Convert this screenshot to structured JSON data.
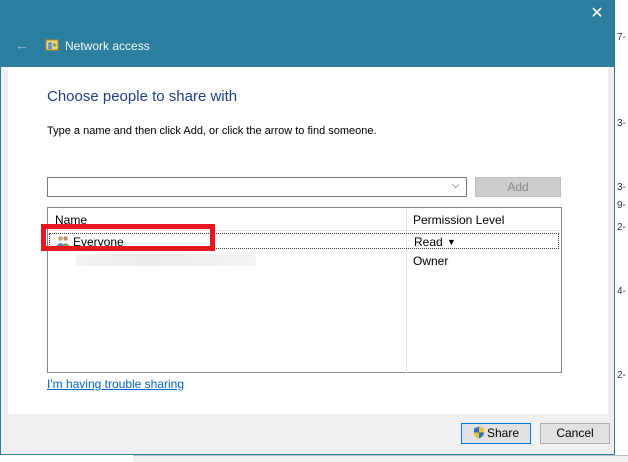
{
  "window": {
    "title": "Network access",
    "heading": "Choose people to share with",
    "instruction": "Type a name and then click Add, or click the arrow to find someone."
  },
  "name_input": {
    "value": "",
    "add_label": "Add"
  },
  "list": {
    "columns": [
      "Name",
      "Permission Level"
    ],
    "rows": [
      {
        "name": "Everyone",
        "permission": "Read"
      },
      {
        "name": "",
        "permission": "Owner"
      }
    ]
  },
  "links": {
    "trouble": "I'm having trouble sharing"
  },
  "buttons": {
    "share": "Share",
    "cancel": "Cancel"
  },
  "colors": {
    "titlebar": "#2c7e9e",
    "heading": "#1f3f8f",
    "highlight": "#e8161f",
    "link": "#0066cc"
  },
  "icons": [
    "back-arrow-icon",
    "network-share-icon",
    "close-icon",
    "chevron-down-icon",
    "users-icon",
    "uac-shield-icon"
  ]
}
